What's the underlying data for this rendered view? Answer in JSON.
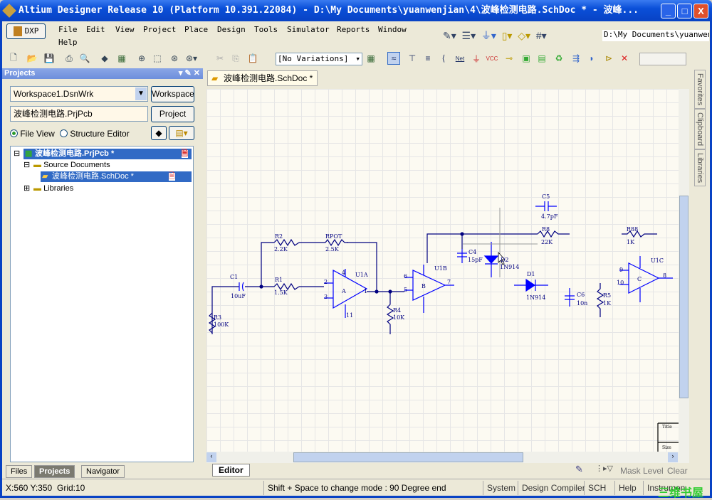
{
  "window": {
    "title": "Altium Designer Release 10 (Platform 10.391.22084) - D:\\My Documents\\yuanwenjian\\4\\波峰检测电路.SchDoc * - 波峰..."
  },
  "menu": {
    "dxp": "DXP",
    "items": [
      "File",
      "Edit",
      "View",
      "Project",
      "Place",
      "Design",
      "Tools",
      "Simulator",
      "Reports",
      "Window",
      "Help"
    ],
    "path": "D:\\My Documents\\yuanwenjian"
  },
  "toolbar": {
    "variations": "[No Variations]",
    "net_label": "Net",
    "vcc_label": "VCC"
  },
  "panel": {
    "title": "Projects",
    "workspace_value": "Workspace1.DsnWrk",
    "workspace_button": "Workspace",
    "project_value": "波峰检测电路.PrjPcb",
    "project_button": "Project",
    "radio_file_view": "File View",
    "radio_structure": "Structure Editor",
    "tree": {
      "project": "波峰检测电路.PrjPcb *",
      "source": "Source Documents",
      "schdoc": "波峰检测电路.SchDoc *",
      "libraries": "Libraries"
    },
    "tabs": [
      "Files",
      "Projects",
      "Navigator"
    ]
  },
  "document": {
    "tab": "波峰检测电路.SchDoc *",
    "editor_tab": "Editor"
  },
  "side_tabs": [
    "Favorites",
    "Clipboard",
    "Libraries"
  ],
  "bottom_right": {
    "mask_level": "Mask Level",
    "clear": "Clear"
  },
  "schematic": {
    "C1": "C1",
    "C1v": "10uF",
    "R2": "R2",
    "R2v": "2.2K",
    "RPOT": "RPOT",
    "RPOTv": "2.5K",
    "R1": "R1",
    "R1v": "1.5K",
    "R3": "R3",
    "R3v": "100K",
    "U1A": "U1A",
    "A": "A",
    "R4": "R4",
    "R4v": "10K",
    "U1B": "U1B",
    "B": "B",
    "C4": "C4",
    "C4v": "15pF",
    "D2": "D2",
    "D2v": "1N914",
    "C5": "C5",
    "C5v": "4.7pF",
    "R8": "R8",
    "R8v": "22K",
    "D1": "D1",
    "D1v": "1N914",
    "C6": "C6",
    "C6v": "10n",
    "R5": "R5",
    "R5v": "1K",
    "R88": "R88",
    "R88v": "1K",
    "U1C": "U1C",
    "C": "C",
    "p1": "1",
    "p2": "2",
    "p3": "3",
    "p4": "4",
    "p5": "5",
    "p6": "6",
    "p7": "7",
    "p8": "8",
    "p9": "9",
    "p10": "10",
    "p11": "11",
    "tb1": "Title",
    "tb2": "Size"
  },
  "status": {
    "coords": "X:560 Y:350",
    "grid": "Grid:10",
    "message": "Shift + Space to change mode : 90 Degree end",
    "buttons": [
      "System",
      "Design Compiler",
      "SCH",
      "Help",
      "Instruments"
    ],
    "watermark": "三维书屋"
  }
}
